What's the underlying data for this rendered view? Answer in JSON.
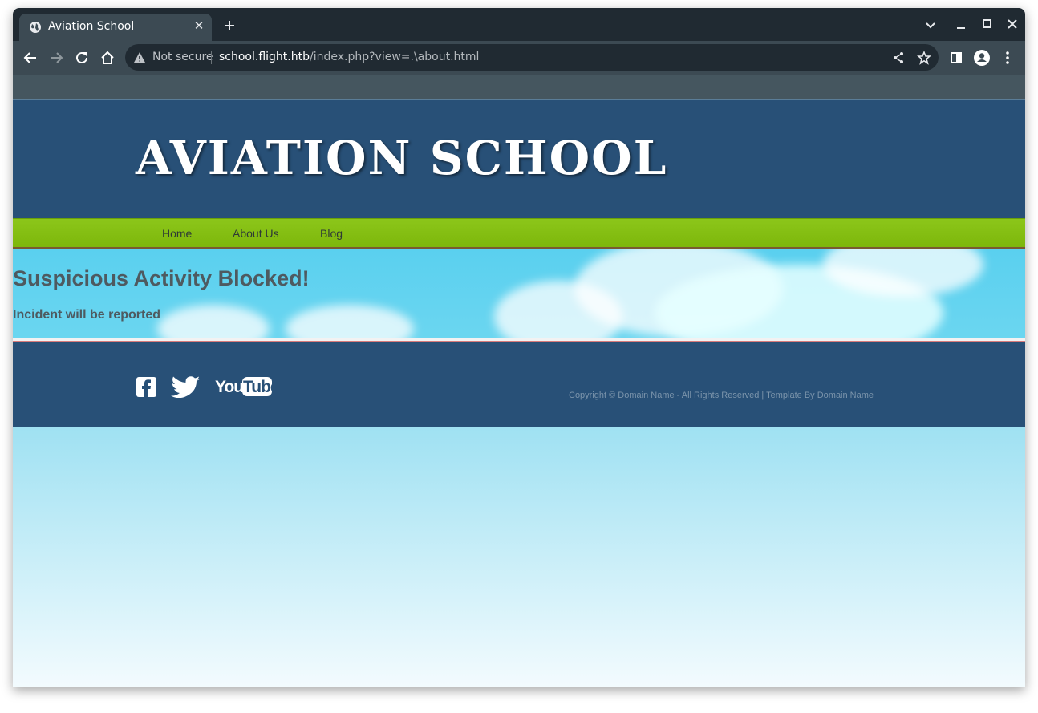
{
  "browser": {
    "tab_title": "Aviation School",
    "not_secure": "Not secure",
    "url_host": "school.flight.htb",
    "url_path": "/index.php?view=.\\about.html"
  },
  "site": {
    "title": "AVIATION SCHOOL",
    "nav": [
      "Home",
      "About Us",
      "Blog"
    ],
    "heading": "Suspicious Activity Blocked!",
    "subheading": "Incident will be reported",
    "social": [
      "facebook-icon",
      "twitter-icon",
      "youtube-icon"
    ],
    "youtube_text": "YouTube",
    "copyright": "Copyright © Domain Name - All Rights Reserved | Template By Domain Name"
  },
  "colors": {
    "header_blue": "#285077",
    "nav_green": "#84c011",
    "sky": "#5ad0ef",
    "text_gray": "#4e5a60"
  }
}
